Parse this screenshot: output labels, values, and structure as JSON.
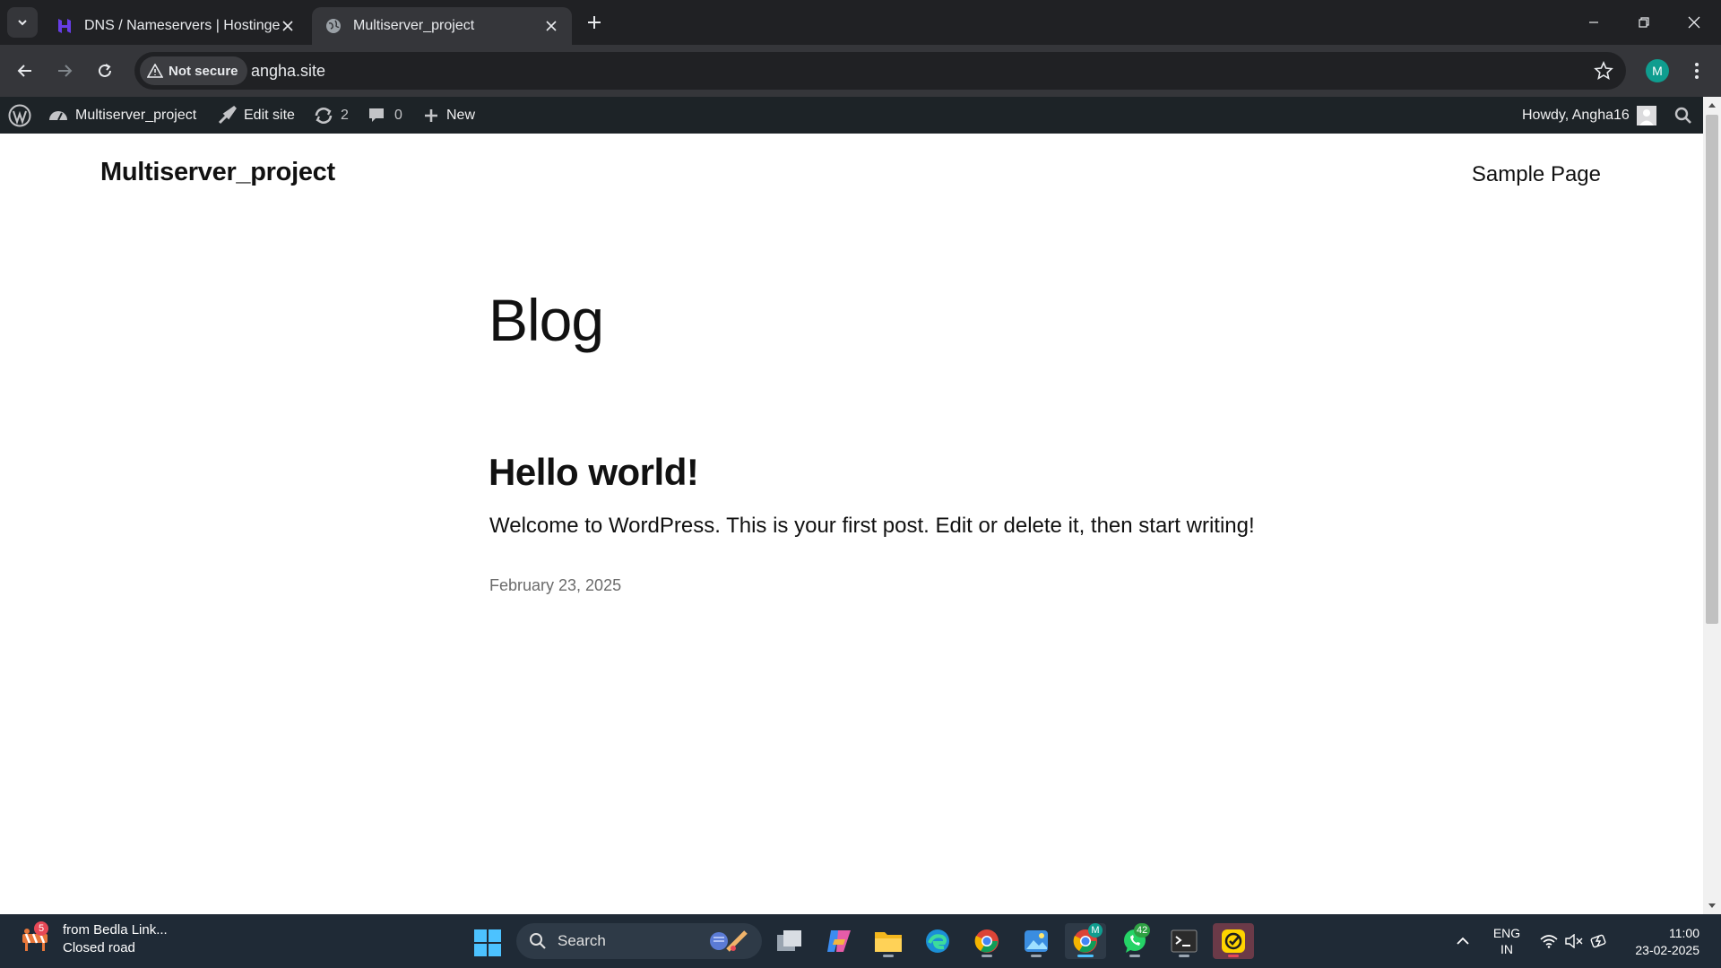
{
  "browser": {
    "tabs": [
      {
        "title": "DNS / Nameservers | Hostinger",
        "active": false
      },
      {
        "title": "Multiserver_project",
        "active": true
      }
    ],
    "security_chip": "Not secure",
    "url": "angha.site",
    "profile_initial": "M"
  },
  "adminbar": {
    "site_name": "Multiserver_project",
    "edit_site": "Edit site",
    "updates_count": "2",
    "comments_count": "0",
    "new_label": "New",
    "greeting": "Howdy, Angha16"
  },
  "site": {
    "title": "Multiserver_project",
    "nav_item": "Sample Page",
    "page_heading": "Blog",
    "posts": [
      {
        "title": "Hello world!",
        "excerpt": "Welcome to WordPress. This is your first post. Edit or delete it, then start writing!",
        "date": "February 23, 2025"
      }
    ]
  },
  "taskbar": {
    "notification_count": "5",
    "weather_line1": "from Bedla Link...",
    "weather_line2": "Closed road",
    "search_label": "Search",
    "chrome_badge": "M",
    "whatsapp_badge": "42",
    "language": "ENG",
    "region": "IN",
    "time": "11:00",
    "date": "23-02-2025"
  },
  "colors": {
    "adminbar_bg": "#1d2327",
    "taskbar_bg": "#1f2a36",
    "hostinger_purple": "#673de6",
    "profile_teal": "#0f9d8f"
  }
}
